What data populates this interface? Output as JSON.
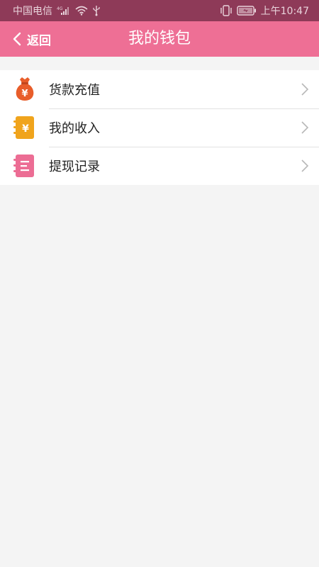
{
  "status_bar": {
    "carrier": "中国电信",
    "network": "4G",
    "time": "上午10:47"
  },
  "header": {
    "back_label": "返回",
    "title": "我的钱包"
  },
  "menu": {
    "items": [
      {
        "label": "货款充值",
        "icon": "money-bag-icon"
      },
      {
        "label": "我的收入",
        "icon": "yen-notebook-icon"
      },
      {
        "label": "提现记录",
        "icon": "record-list-icon"
      }
    ]
  },
  "colors": {
    "status_bar": "#8e3a58",
    "header": "#ee6f95",
    "money_bag": "#e85d2a",
    "income": "#f0a41c",
    "record": "#ec6d94",
    "background": "#f4f4f4"
  }
}
